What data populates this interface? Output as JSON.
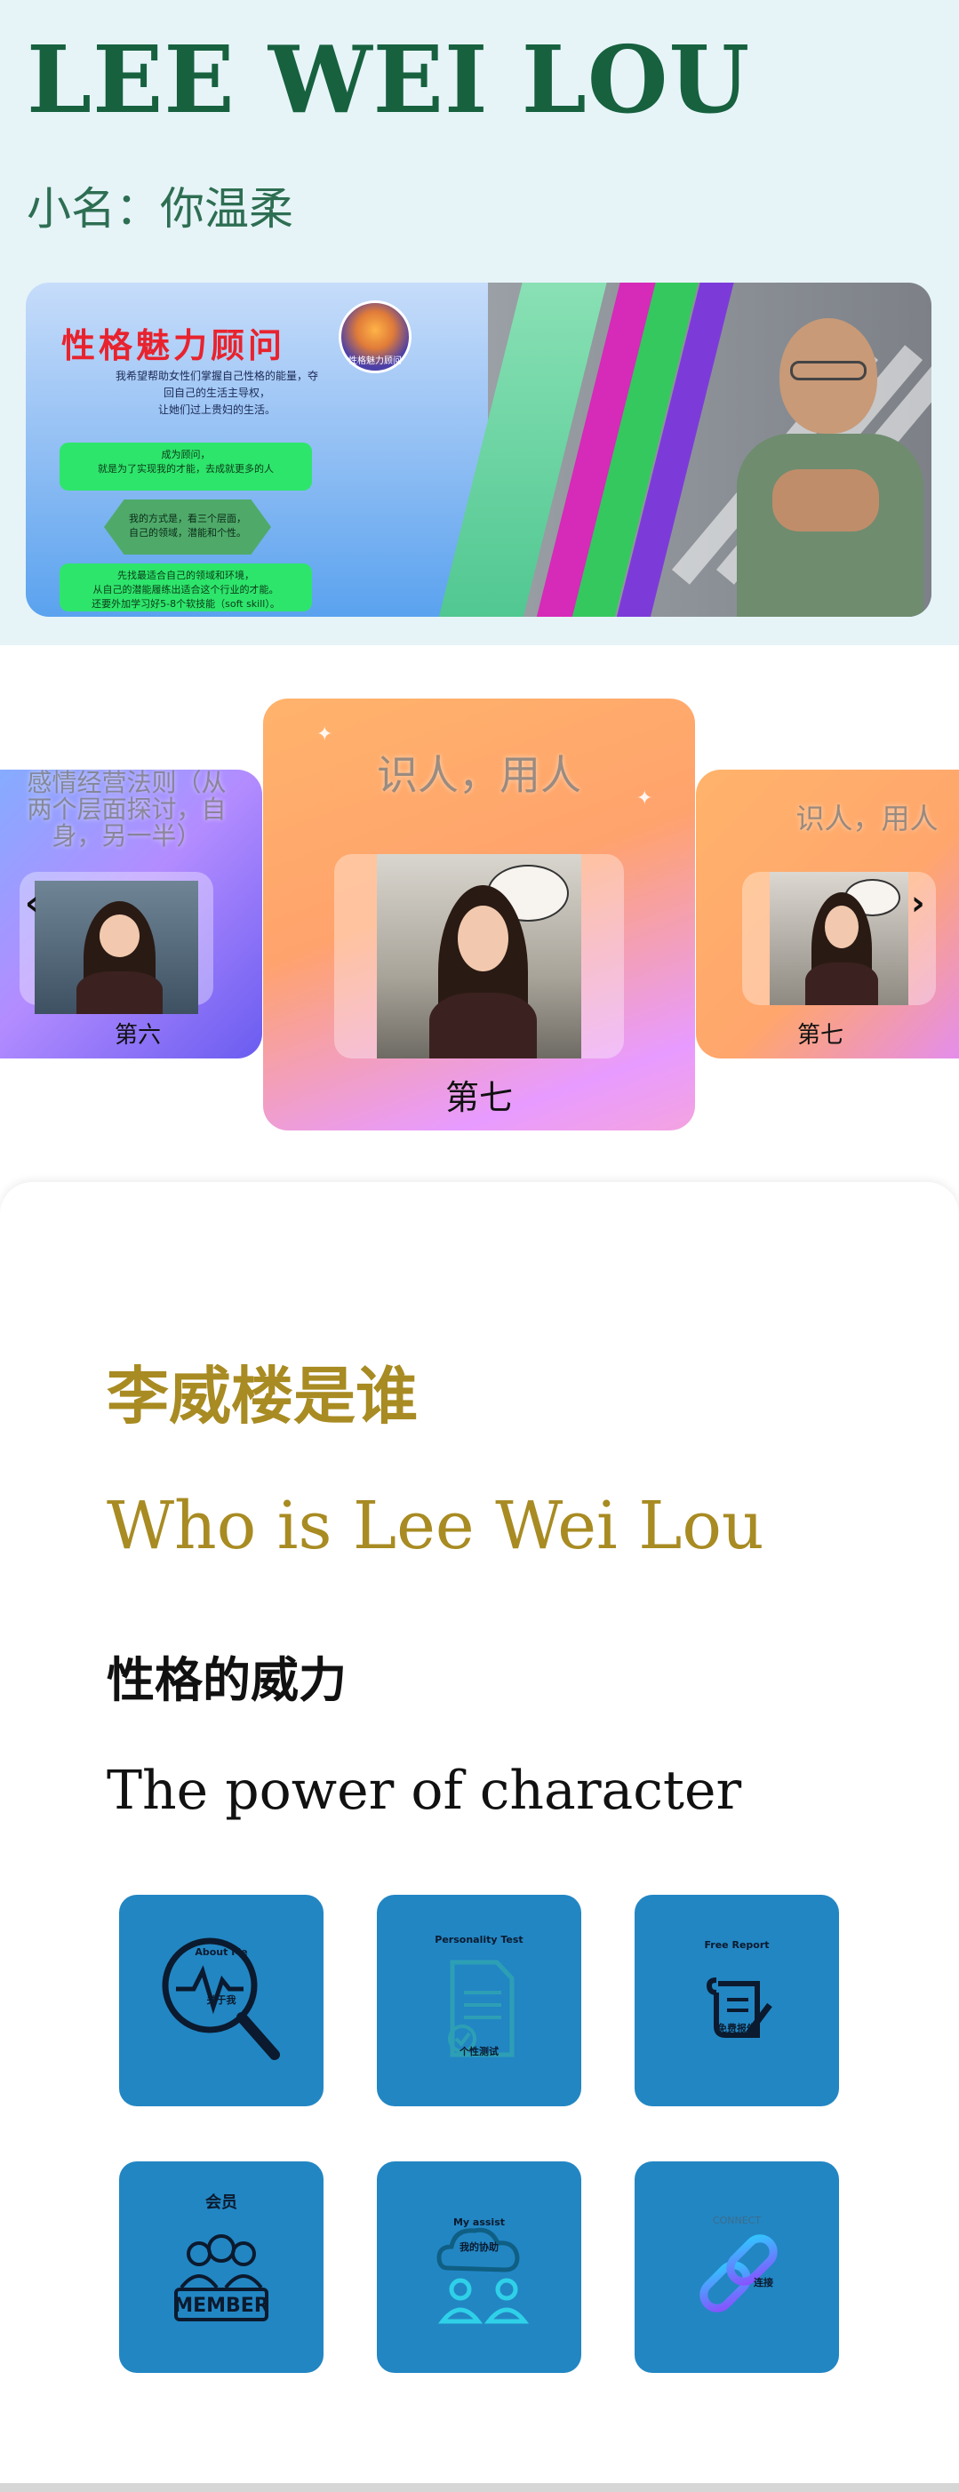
{
  "header": {
    "title": "LEE WEI LOU",
    "nickname": "小名：你温柔"
  },
  "banner": {
    "heading": "性格魅力顾问",
    "logo_text": "性格魅力顾问",
    "desc_line1": "我希望帮助女性们掌握自己性格的能量，夺",
    "desc_line2": "回自己的生活主导权，",
    "desc_line3": "让她们过上贵妇的生活。",
    "box1_line1": "成为顾问，",
    "box1_line2": "就是为了实现我的才能，去成就更多的人",
    "box2_line1": "我的方式是，看三个层面，",
    "box2_line2": "自己的领域，潜能和个性。",
    "box3_line1": "先找最适合自己的领域和环境，",
    "box3_line2": "从自己的潜能履练出适合这个行业的才能。",
    "box3_line3": "还要外加学习好5-8个软技能（soft skill）。"
  },
  "carousel": {
    "prev_label": "‹",
    "next_label": "›",
    "cards": [
      {
        "title": "感情经营法则（从两个层面探讨，自身，另一半）",
        "caption": "第六"
      },
      {
        "title": "识人，用人",
        "caption": "第七"
      },
      {
        "title": "识人，用人",
        "caption": "第七"
      }
    ]
  },
  "about": {
    "heading_cn": "李威楼是谁",
    "heading_en": "Who is Lee Wei Lou",
    "sub_cn": "性格的威力",
    "sub_en": "The power of character"
  },
  "tiles": [
    {
      "label_top": "About Me",
      "label_bottom": "关于我",
      "icon": "magnifier-pulse-icon"
    },
    {
      "label_top": "Personality Test",
      "label_bottom": "个性测试",
      "icon": "document-check-icon"
    },
    {
      "label_top": "Free Report",
      "label_bottom": "免费报告",
      "icon": "scroll-pen-icon"
    },
    {
      "label_top": "会员",
      "label_bottom": "MEMBER",
      "icon": "member-group-icon"
    },
    {
      "label_top": "My assist",
      "label_bottom": "我的协助",
      "icon": "cloud-people-icon"
    },
    {
      "label_top": "CONNECT",
      "label_bottom": "连接",
      "icon": "chain-link-icon"
    }
  ],
  "colors": {
    "title_green": "#17613f",
    "header_bg": "#e6f4f8",
    "gold": "#a88b22",
    "tile_blue": "#2286c3"
  }
}
